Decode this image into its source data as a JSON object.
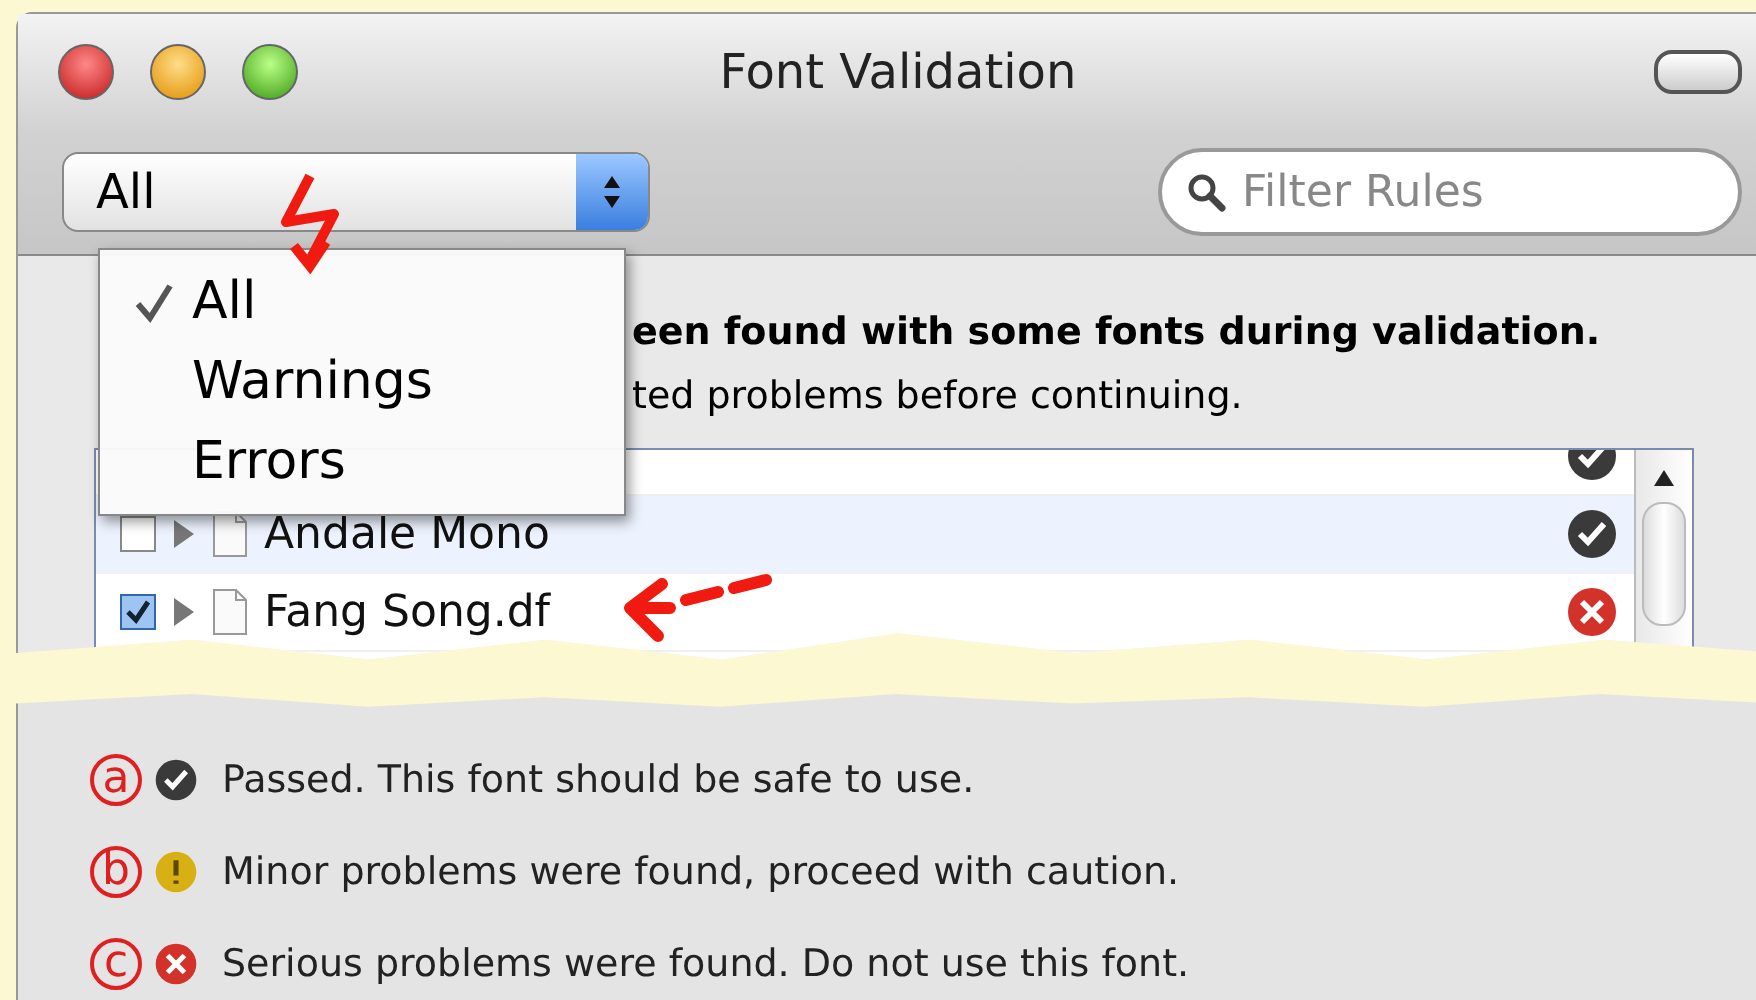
{
  "window": {
    "title": "Font Validation"
  },
  "toolbar": {
    "filter_popup": {
      "value": "All"
    },
    "search": {
      "placeholder": "Filter Rules"
    }
  },
  "filter_menu": [
    {
      "label": "All",
      "selected": true
    },
    {
      "label": "Warnings",
      "selected": false
    },
    {
      "label": "Errors",
      "selected": false
    }
  ],
  "message": {
    "line_1": "een found with some fonts during validation.",
    "line_2": "ted problems before continuing."
  },
  "fonts": [
    {
      "kind": "passed"
    },
    {
      "name": "Andale Mono",
      "checked": false,
      "kind": "passed"
    },
    {
      "name": "Fang Song.df",
      "checked": true,
      "kind": "error"
    }
  ],
  "legend": [
    {
      "letter": "a",
      "kind": "passed",
      "text": "Passed. This font should be safe to use."
    },
    {
      "letter": "b",
      "kind": "warning",
      "text": "Minor problems were found, proceed with caution."
    },
    {
      "letter": "c",
      "kind": "error",
      "text": "Serious problems were found. Do not use this font."
    }
  ]
}
